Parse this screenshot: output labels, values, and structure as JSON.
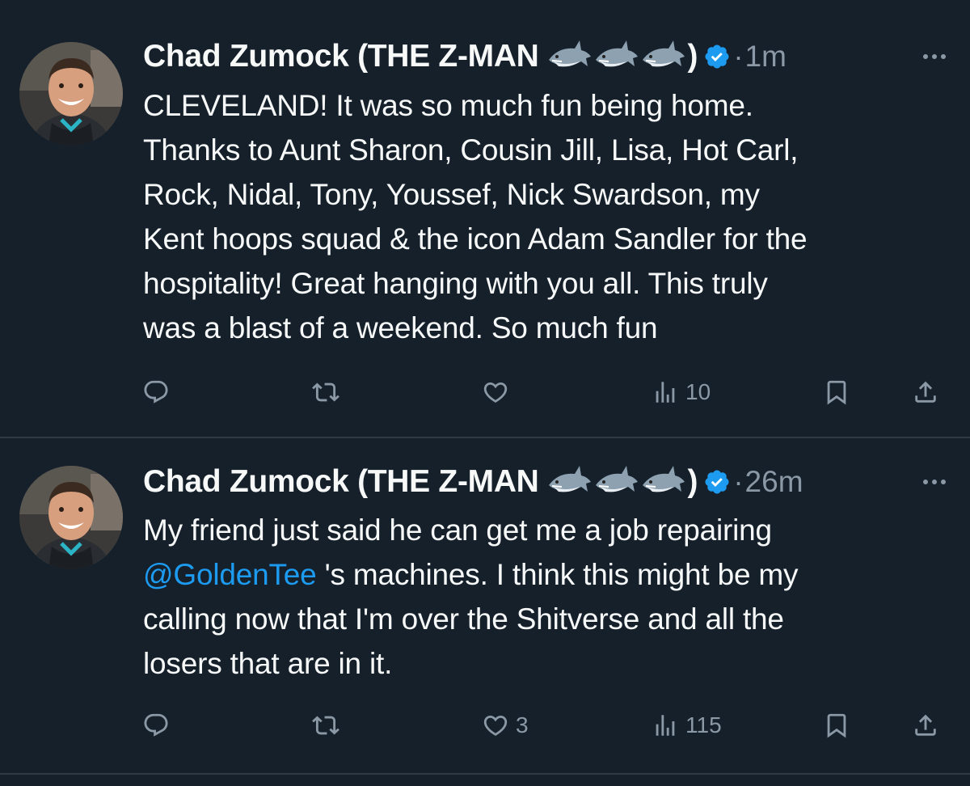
{
  "colors": {
    "background": "#15202b",
    "text": "#f7f9f9",
    "muted": "#8b98a5",
    "link": "#1d9bf0",
    "verified": "#1d9bf0",
    "divider": "#2f3a44"
  },
  "tweets": [
    {
      "author_name": "Chad Zumock (THE Z-MAN",
      "name_emojis": [
        "shark-emoji",
        "shark-emoji",
        "shark-emoji"
      ],
      "name_close": ")",
      "verified": true,
      "time_separator": "·",
      "time": "1m",
      "text": "CLEVELAND! It was so much fun being home.\nThanks to Aunt Sharon, Cousin Jill, Lisa, Hot Carl,\nRock, Nidal, Tony, Youssef, Nick Swardson, my\nKent hoops squad &  the icon Adam Sandler for the\nhospitality! Great hanging with you all. This truly\nwas a blast of a weekend. So much fun",
      "actions": {
        "reply_count": "",
        "retweet_count": "",
        "like_count": "",
        "views_count": "10"
      }
    },
    {
      "author_name": "Chad Zumock (THE Z-MAN",
      "name_emojis": [
        "shark-emoji",
        "shark-emoji",
        "shark-emoji"
      ],
      "name_close": ")",
      "verified": true,
      "time_separator": "·",
      "time": "26m",
      "text_before_mention": "My friend just said he can get me a job repairing\n",
      "mention": "@GoldenTee",
      "text_after_mention": " 's machines. I think this might be my\ncalling now that I'm over the Shitverse and all the\nlosers that are in it.",
      "actions": {
        "reply_count": "",
        "retweet_count": "",
        "like_count": "3",
        "views_count": "115"
      }
    }
  ]
}
